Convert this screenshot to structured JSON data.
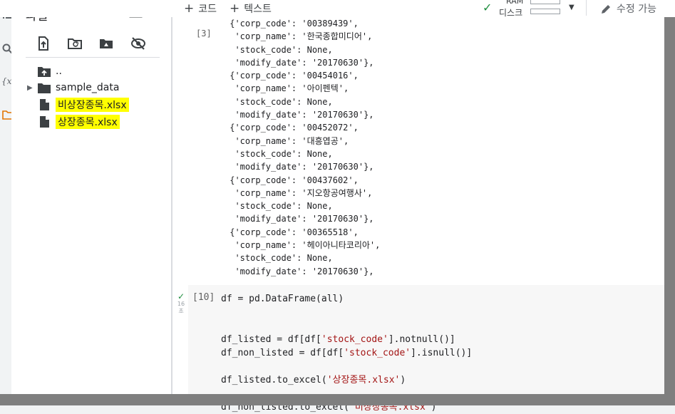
{
  "toolbar": {
    "add_code_label": "코드",
    "add_text_label": "텍스트",
    "ram_label": "RAM",
    "disk_label": "디스크",
    "edit_label": "수정 가능"
  },
  "file_panel": {
    "title": "파일",
    "parent_dir": "..",
    "items": [
      {
        "name": "sample_data",
        "type": "folder",
        "highlighted": false
      },
      {
        "name": "비상장종목.xlsx",
        "type": "file",
        "highlighted": true
      },
      {
        "name": "상장종목.xlsx",
        "type": "file",
        "highlighted": true
      }
    ]
  },
  "output": {
    "prompt": "[3]",
    "lines": [
      " {'corp_code': '00389439',",
      "  'corp_name': '한국종합미디어',",
      "  'stock_code': None,",
      "  'modify_date': '20170630'},",
      " {'corp_code': '00454016',",
      "  'corp_name': '아이펜텍',",
      "  'stock_code': None,",
      "  'modify_date': '20170630'},",
      " {'corp_code': '00452072',",
      "  'corp_name': '대흥엽공',",
      "  'stock_code': None,",
      "  'modify_date': '20170630'},",
      " {'corp_code': '00437602',",
      "  'corp_name': '지오항공여행사',",
      "  'stock_code': None,",
      "  'modify_date': '20170630'},",
      " {'corp_code': '00365518',",
      "  'corp_name': '헤이아니타코리아',",
      "  'stock_code': None,",
      "  'modify_date': '20170630'},"
    ]
  },
  "code_cell": {
    "prompt": "[10]",
    "exec_time": "16\n초",
    "line_df": "df = pd.DataFrame(all)",
    "line_listed_a": "df_listed = df[df[",
    "line_listed_str": "'stock_code'",
    "line_listed_b": "].notnull()]",
    "line_non_a": "df_non_listed = df[df[",
    "line_non_str": "'stock_code'",
    "line_non_b": "].isnull()]",
    "line_excel1_a": "df_listed.to_excel(",
    "line_excel1_str": "'상장종목.xlsx'",
    "line_excel1_b": ")",
    "line_excel2_a": "df_non_listed.to_excel(",
    "line_excel2_str": "'비상장종목.xlsx'",
    "line_excel2_b": ")"
  },
  "colors": {
    "highlight": "#ffff00",
    "string_literal": "#a31515",
    "success": "#1e8e3e"
  }
}
